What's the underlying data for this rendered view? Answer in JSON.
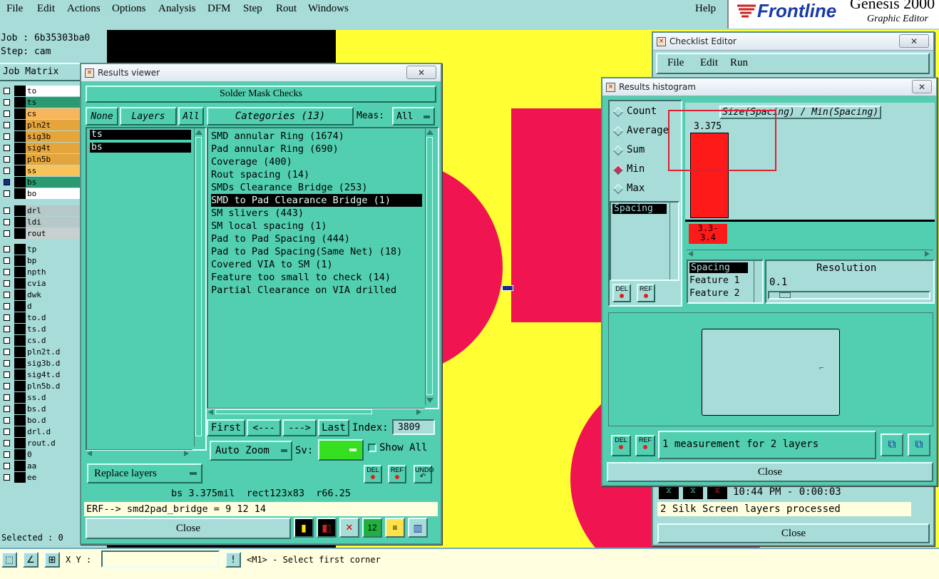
{
  "menubar": {
    "items": [
      "File",
      "Edit",
      "Actions",
      "Options",
      "Analysis",
      "DFM",
      "Step",
      "Rout",
      "Windows"
    ],
    "help": "Help",
    "brand": "Frontline",
    "product": "Genesis 2000",
    "subtitle": "Graphic Editor"
  },
  "job": {
    "job_label": "Job : 6b35303ba0",
    "step_label": "Step: cam",
    "matrix_label": "Job Matrix"
  },
  "layers": [
    {
      "name": "to",
      "color": "#ffffff"
    },
    {
      "name": "ts",
      "color": "#2a9a73"
    },
    {
      "name": "cs",
      "color": "#f7b65a"
    },
    {
      "name": "pln2t",
      "color": "#e6a53a"
    },
    {
      "name": "sig3b",
      "color": "#e6a53a"
    },
    {
      "name": "sig4t",
      "color": "#e6a53a"
    },
    {
      "name": "pln5b",
      "color": "#e6a53a"
    },
    {
      "name": "ss",
      "color": "#f8c35a"
    },
    {
      "name": "bs",
      "color": "#2a9a73"
    },
    {
      "name": "bo",
      "color": "#ffffff"
    },
    {
      "name": "drl",
      "color": "#b8c8c8"
    },
    {
      "name": "ldi",
      "color": "#b8c8c8"
    },
    {
      "name": "rout",
      "color": "#c8d0d0"
    },
    {
      "name": "tp",
      "color": "#a8dcd8"
    },
    {
      "name": "bp",
      "color": "#a8dcd8"
    },
    {
      "name": "npth",
      "color": "#a8dcd8"
    },
    {
      "name": "cvia",
      "color": "#a8dcd8"
    },
    {
      "name": "dwk",
      "color": "#a8dcd8"
    },
    {
      "name": "d",
      "color": "#a8dcd8"
    },
    {
      "name": "to.d",
      "color": "#a8dcd8"
    },
    {
      "name": "ts.d",
      "color": "#a8dcd8"
    },
    {
      "name": "cs.d",
      "color": "#a8dcd8"
    },
    {
      "name": "pln2t.d",
      "color": "#a8dcd8"
    },
    {
      "name": "sig3b.d",
      "color": "#a8dcd8"
    },
    {
      "name": "sig4t.d",
      "color": "#a8dcd8"
    },
    {
      "name": "pln5b.d",
      "color": "#a8dcd8"
    },
    {
      "name": "ss.d",
      "color": "#a8dcd8"
    },
    {
      "name": "bs.d",
      "color": "#a8dcd8"
    },
    {
      "name": "bo.d",
      "color": "#a8dcd8"
    },
    {
      "name": "drl.d",
      "color": "#a8dcd8"
    },
    {
      "name": "rout.d",
      "color": "#a8dcd8"
    },
    {
      "name": "0",
      "color": "#a8dcd8"
    },
    {
      "name": "aa",
      "color": "#a8dcd8"
    },
    {
      "name": "ee",
      "color": "#a8dcd8"
    }
  ],
  "statusbar": {
    "selected": "Selected : 0",
    "xy_label": "X Y :",
    "hint": "<M1> - Select first corner",
    "bang": "!"
  },
  "results_viewer": {
    "title": "Results viewer",
    "header": "Solder Mask Checks",
    "none_btn": "None",
    "layers_btn": "Layers",
    "all_btn": "All",
    "categories_btn": "Categories (13)",
    "meas_label": "Meas:",
    "meas_value": "All",
    "layer_list": [
      "ts",
      "bs"
    ],
    "categories": [
      "SMD annular Ring (1674)",
      "Pad annular Ring (690)",
      "Coverage (400)",
      "Rout spacing (14)",
      "SMDs Clearance Bridge (253)",
      "SMD to Pad Clearance Bridge (1)",
      "SM slivers (443)",
      "SM local spacing (1)",
      "Pad to Pad Spacing (444)",
      "Pad to Pad Spacing(Same Net) (18)",
      "Covered VIA to SM (1)",
      "Feature too small to check (14)",
      "Partial Clearance on VIA drilled"
    ],
    "selected_category": 5,
    "nav": {
      "first": "First",
      "prev": "<---",
      "next": "--->",
      "last": "Last",
      "index_label": "Index:",
      "index_value": "3809"
    },
    "auto_zoom": "Auto Zoom",
    "sv_label": "Sv:",
    "show_all": "Show All",
    "replace_layers": "Replace layers",
    "del": "DEL",
    "ref": "REF",
    "undo": "UNDO",
    "info_line": "bs 3.375mil  rect123x83  r66.25",
    "erf_line": "ERF--> smd2pad_bridge = 9 12 14",
    "close": "Close"
  },
  "checklist_editor": {
    "title": "Checklist Editor",
    "menu": [
      "File",
      "Edit",
      "Run"
    ],
    "time": "10:44 PM - 0:00:03",
    "status": "2 Silk Screen layers processed",
    "close": "Close"
  },
  "histogram": {
    "title": "Results histogram",
    "radios": [
      "Count",
      "Average",
      "Sum",
      "Min",
      "Max"
    ],
    "selected_radio": "Min",
    "chart_title": "Size(Spacing) / Min(Spacing)",
    "bar_value_label": "3.375",
    "bar_bin_label": "3.3-\n3.4",
    "list_item": "Spacing",
    "attr_items": [
      "Spacing",
      "Feature 1",
      "Feature 2"
    ],
    "resolution_label": "Resolution",
    "resolution_value": "0.1",
    "measurement_text": "1 measurement for 2 layers",
    "close": "Close",
    "del": "DEL",
    "ref": "REF"
  },
  "chart_data": {
    "type": "bar",
    "title": "Size(Spacing) / Min(Spacing)",
    "categories": [
      "3.3-3.4"
    ],
    "values": [
      3.375
    ],
    "xlabel": "",
    "ylabel": ""
  }
}
